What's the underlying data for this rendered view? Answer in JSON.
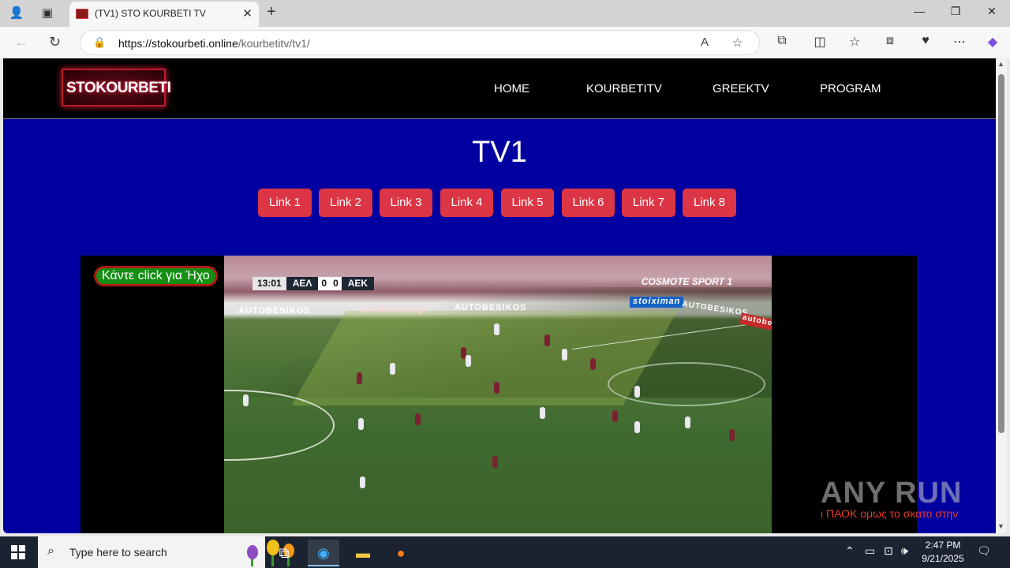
{
  "browser": {
    "tab_title": "(TV1) STO KOURBETI TV",
    "url_host": "https://stokourbeti.online",
    "url_path": "/kourbetitv/tv1/"
  },
  "site": {
    "logo_text": "STOKOURBETI",
    "menu": [
      "HOME",
      "KOURBETITV",
      "GREEKTV",
      "PROGRAM"
    ],
    "page_title": "TV1",
    "links": [
      "Link 1",
      "Link 2",
      "Link 3",
      "Link 4",
      "Link 5",
      "Link 6",
      "Link 7",
      "Link 8"
    ],
    "accent_color": "#dc3545",
    "background_color": "#0000a0"
  },
  "player": {
    "sound_button": "Κάντε click για Ήχο",
    "score": {
      "time": "13:01",
      "home": "ΑΕΛ",
      "home_score": "0",
      "away_score": "0",
      "away": "ΑΕΚ"
    },
    "broadcaster": "COSMOTE SPORT 1",
    "ad_boards": [
      "AUTOBESIKOS",
      "autobesikos.gr",
      "AUTOBESIKOS",
      "stoiximan",
      "AUTOBESIKOS",
      "autobesikos"
    ],
    "marquee": "ι ΠΑΟΚ ομως το σκατο στην"
  },
  "watermark": "ANY RUN",
  "taskbar": {
    "search_placeholder": "Type here to search",
    "time": "2:47 PM",
    "date": "9/21/2025"
  }
}
